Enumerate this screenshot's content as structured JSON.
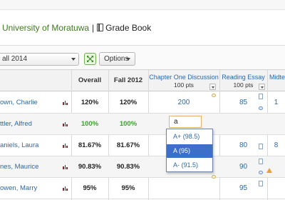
{
  "breadcrumb": {
    "institution": "University of Moratuwa",
    "separator": "|",
    "page": "Grade Book"
  },
  "toolbar": {
    "term": "all 2014",
    "options_label": "Options"
  },
  "columns": {
    "overall": "Overall",
    "term": "Fall 2012",
    "items": [
      {
        "title": "Chapter One Discussion",
        "points": "100 pts"
      },
      {
        "title": "Reading Essay",
        "points": "100 pts"
      },
      {
        "title": "Midterm",
        "points": ""
      }
    ]
  },
  "rows": [
    {
      "name": "own, Charlie",
      "overall": "120%",
      "term": "120%",
      "g1": "200",
      "g2": "85",
      "g3": "1"
    },
    {
      "name": "ttler, Alfred",
      "overall": "100%",
      "term": "100%",
      "g1": "",
      "g2": "",
      "g3": ""
    },
    {
      "name": "aniels, Laura",
      "overall": "81.67%",
      "term": "81.67%",
      "g1": "",
      "g2": "80",
      "g3": "8"
    },
    {
      "name": "nes, Maurice",
      "overall": "90.83%",
      "term": "90.83%",
      "g1": "",
      "g2": "90",
      "g3": ""
    },
    {
      "name": "owen, Marry",
      "overall": "95%",
      "term": "95%",
      "g1": "",
      "g2": "95",
      "g3": ""
    }
  ],
  "editor": {
    "value": "a",
    "suggestions": [
      {
        "label": "A+ (98.5)",
        "selected": false
      },
      {
        "label": "A (95)",
        "selected": true
      },
      {
        "label": "A- (91.5)",
        "selected": false
      }
    ]
  },
  "colors": {
    "link": "#2e67a9",
    "brand_green": "#3f7a1e",
    "success": "#3da12f",
    "selection": "#3b6fc9"
  }
}
